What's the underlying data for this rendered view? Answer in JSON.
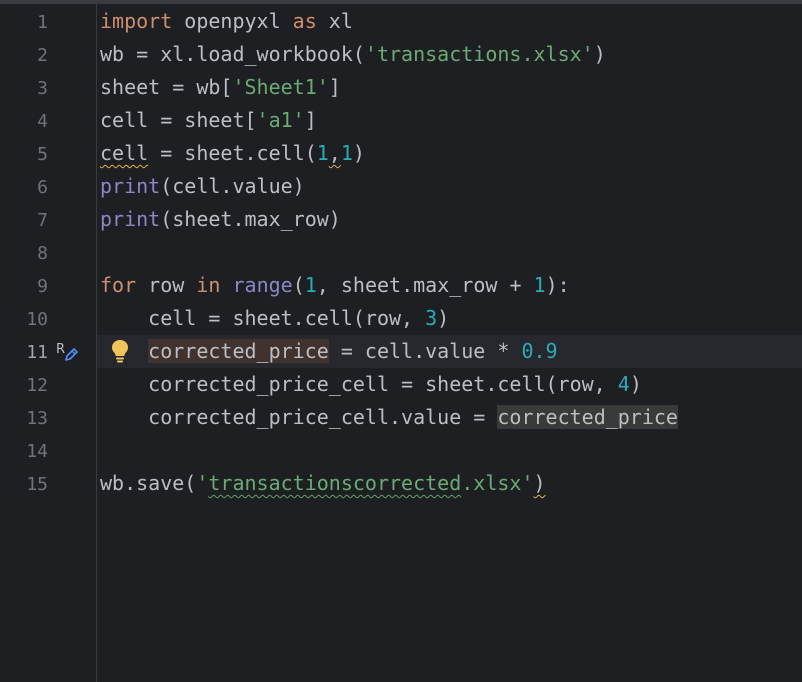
{
  "editor": {
    "line_numbers": [
      "1",
      "2",
      "3",
      "4",
      "5",
      "6",
      "7",
      "8",
      "9",
      "10",
      "11",
      "12",
      "13",
      "14",
      "15"
    ],
    "current_line": "11",
    "gutter_icon_letter": "R",
    "lines": {
      "l1": {
        "import": "import",
        "sp1": " openpyxl ",
        "as": "as",
        "sp2": " xl"
      },
      "l2": {
        "a": "wb = xl.load_workbook(",
        "s": "'transactions.xlsx'",
        "b": ")"
      },
      "l3": {
        "a": "sheet = wb[",
        "s": "'Sheet1'",
        "b": "]"
      },
      "l4": {
        "a": "cell = sheet[",
        "s": "'a1'",
        "b": "]"
      },
      "l5": {
        "cell": "cell",
        "a": " = sheet.cell(",
        "n1": "1",
        "comma": ",",
        "n2": "1",
        "b": ")"
      },
      "l6": {
        "print": "print",
        "a": "(cell.value)"
      },
      "l7": {
        "print": "print",
        "a": "(sheet.max_row)"
      },
      "l9": {
        "for": "for",
        "a": " row ",
        "in": "in",
        "sp": " ",
        "range": "range",
        "b": "(",
        "n1": "1",
        "c": ", sheet.max_row + ",
        "n2": "1",
        "d": "):"
      },
      "l10": {
        "a": "    cell = sheet.cell(row, ",
        "n": "3",
        "b": ")"
      },
      "l11": {
        "indent": "    ",
        "var": "corrected_price",
        "a": " = cell.value * ",
        "n": "0.9"
      },
      "l12": {
        "a": "    corrected_price_cell = sheet.cell(row, ",
        "n": "4",
        "b": ")"
      },
      "l13": {
        "a": "    corrected_price_cell.value = ",
        "var": "corrected_price"
      },
      "l15": {
        "a": "wb.save(",
        "q1": "'",
        "s": "transactionscorrected",
        "q2": ".xlsx'",
        "b": ")"
      }
    }
  },
  "colors": {
    "background": "#1e1f22",
    "keyword": "#cf8e6d",
    "string": "#6aab73",
    "number": "#2aacb8",
    "builtin": "#8888c6",
    "text": "#bcbec4",
    "line_number": "#6f737a",
    "bulb": "#f2c55c"
  }
}
